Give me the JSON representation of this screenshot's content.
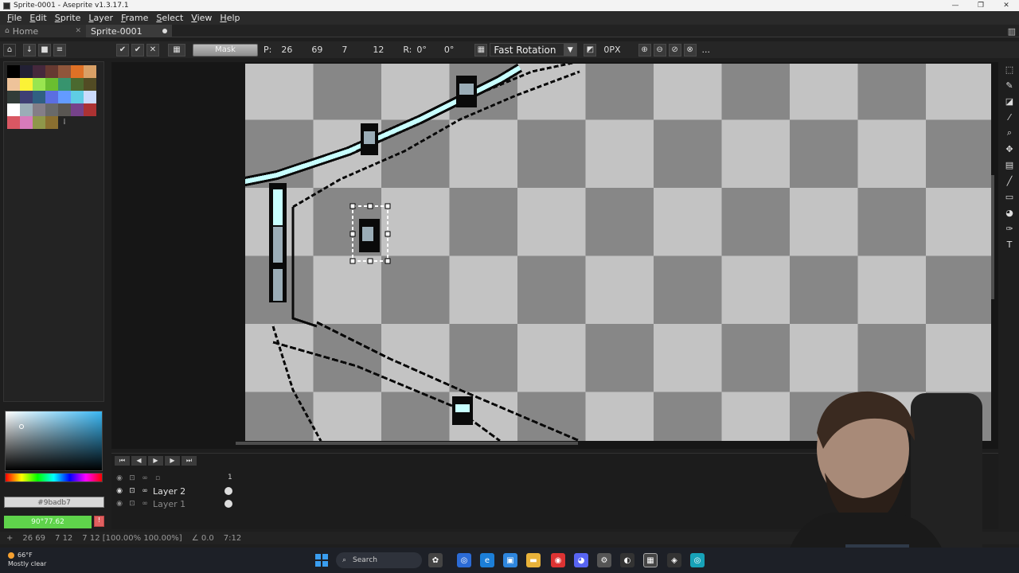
{
  "window": {
    "title": "Sprite-0001 - Aseprite v1.3.17.1",
    "controls": [
      "—",
      "❐",
      "✕"
    ]
  },
  "menu": [
    "File",
    "Edit",
    "Sprite",
    "Layer",
    "Frame",
    "Select",
    "View",
    "Help"
  ],
  "tabs": {
    "home": "Home",
    "sprite": "Sprite-0001"
  },
  "context_bar": {
    "mask_label": "Mask",
    "pos_label": "P:",
    "pos_x": "26",
    "pos_y": "69",
    "size_w": "7",
    "size_h": "12",
    "rot_label": "R:",
    "rot_angle": "0°",
    "skew": "0°",
    "rotation_algorithm": "Fast Rotation",
    "pivot_px": "0PX",
    "more": "..."
  },
  "palette": {
    "colors": [
      "#000000",
      "#222034",
      "#45283c",
      "#663931",
      "#8f563b",
      "#df7126",
      "#d9a066",
      "#eec39a",
      "#fbf236",
      "#99e550",
      "#6abe30",
      "#37946e",
      "#4b692f",
      "#524b24",
      "#323c39",
      "#3f3f74",
      "#306082",
      "#5b6ee1",
      "#639bff",
      "#5fcde4",
      "#cbdbfc",
      "#ffffff",
      "#9badb7",
      "#847e87",
      "#696a6a",
      "#595652",
      "#76428a",
      "#ac3232",
      "#d95763",
      "#d77bba",
      "#8f974a",
      "#8a6f30"
    ],
    "more_label": "⁞"
  },
  "color_picker": {
    "hex": "#9badb7",
    "fg_value": "90°77.62"
  },
  "timeline": {
    "frame_number": "1",
    "layers": [
      {
        "name": "Layer 2"
      },
      {
        "name": "Layer 1"
      }
    ]
  },
  "status": {
    "position": "26 69",
    "size": "7 12",
    "selection_info": "7 12 [100.00% 100.00%]",
    "angle": "∠ 0.0",
    "extra": "7:12"
  },
  "taskbar": {
    "weather_temp": "66°F",
    "weather_desc": "Mostly clear",
    "search_placeholder": "Search"
  },
  "colors": {
    "accent_green": "#5fd34b",
    "light_cyan": "#c8ffff",
    "checker_dark": "#878787",
    "checker_light": "#c3c3c3"
  }
}
